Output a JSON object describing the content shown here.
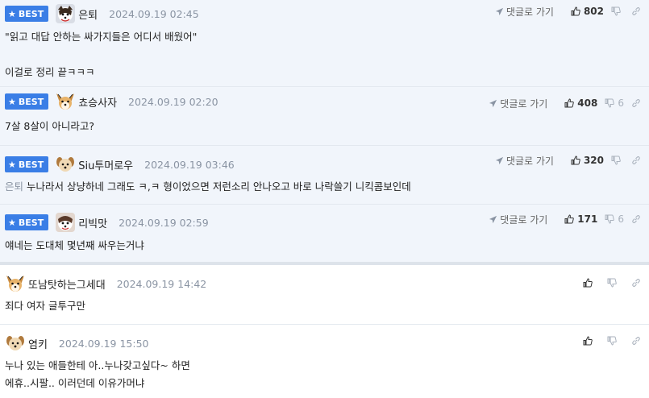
{
  "best_label": "BEST",
  "goto_reply_label": "댓글로 가기",
  "comments": [
    {
      "nickname": "은퇴",
      "date": "2024.09.19 02:45",
      "upvotes": "802",
      "downvotes": "",
      "text_lines": [
        "\"읽고 대답 안하는 싸가지들은 어디서 배웠어\"",
        "",
        "이걸로 정리 끝ㅋㅋㅋ"
      ]
    },
    {
      "nickname": "쵸승사자",
      "date": "2024.09.19 02:20",
      "upvotes": "408",
      "downvotes": "6",
      "text_lines": [
        "7살 8살이 아니라고?"
      ]
    },
    {
      "nickname": "Siu투머로우",
      "date": "2024.09.19 03:46",
      "upvotes": "320",
      "downvotes": "",
      "mention": "은퇴",
      "text_lines": [
        "누나라서 상냥하네 그래도 ㅋ,ㅋ 형이었으면 저런소리 안나오고 바로 나락쓸기 니킥콤보인데"
      ]
    },
    {
      "nickname": "리빅맛",
      "date": "2024.09.19 02:59",
      "upvotes": "171",
      "downvotes": "6",
      "text_lines": [
        "얘네는 도대체 몇년째 싸우는거냐"
      ]
    },
    {
      "nickname": "또남탓하는그세대",
      "date": "2024.09.19 14:42",
      "upvotes": "",
      "downvotes": "",
      "text_lines": [
        "죄다 여자 글투구만"
      ]
    },
    {
      "nickname": "염키",
      "date": "2024.09.19 15:50",
      "upvotes": "",
      "downvotes": "",
      "text_lines": [
        "누나 있는 애들한테 아..누나갖고싶다~ 하면",
        "에휴..시팔.. 이러던데 이유가머냐"
      ]
    }
  ]
}
